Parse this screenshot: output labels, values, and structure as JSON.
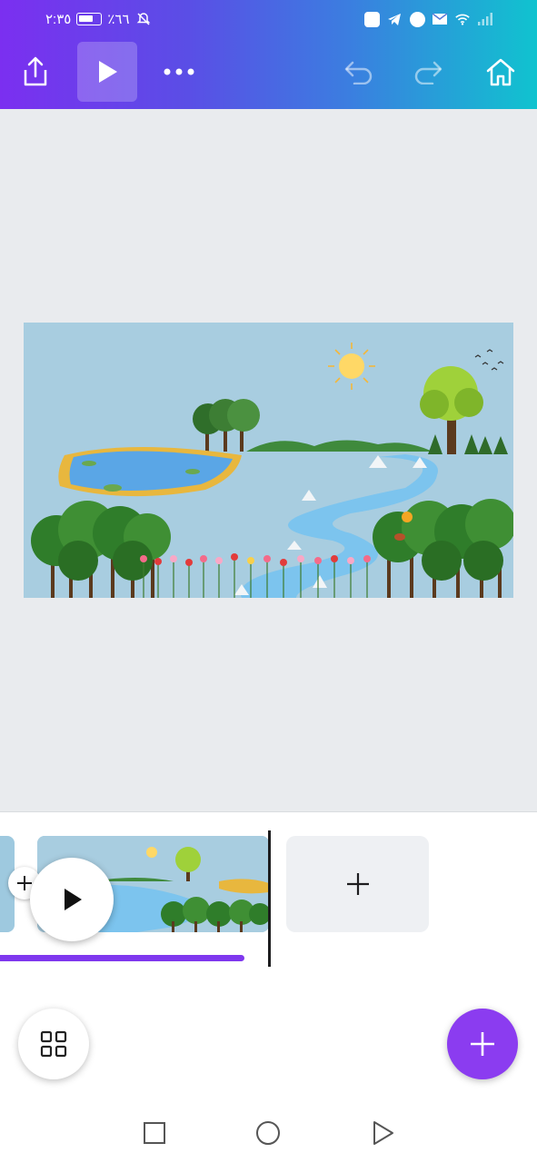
{
  "status_bar": {
    "time": "٢:٣٥",
    "battery_percent": "٪٦٦",
    "icons": [
      "bell-off-icon",
      "battery-icon",
      "app-notification-icon",
      "telegram-icon",
      "messenger-icon",
      "mail-icon",
      "wifi-icon",
      "signal-icon"
    ]
  },
  "toolbar": {
    "icons": [
      "share-icon",
      "play-icon",
      "more-icon",
      "undo-icon",
      "redo-icon",
      "home-icon"
    ]
  },
  "timeline": {
    "progress": 0.455
  },
  "colors": {
    "gradient_start": "#7b2ff0",
    "gradient_end": "#10c3cf",
    "accent": "#8b3cf0",
    "canvas_bg": "#e9ebee"
  }
}
